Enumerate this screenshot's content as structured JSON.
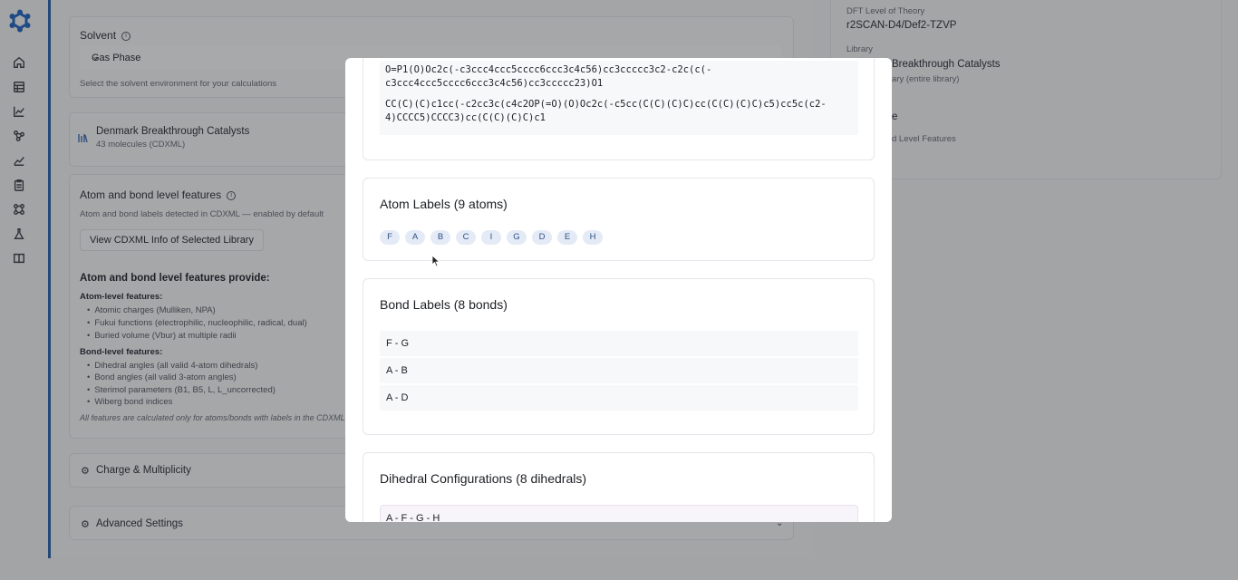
{
  "nav": {
    "icons": [
      "home-icon",
      "table-icon",
      "chart-line-icon",
      "molecule-icon",
      "trend-icon",
      "clipboard-icon",
      "network-icon",
      "flask-icon",
      "book-icon"
    ]
  },
  "solvent": {
    "label": "Solvent",
    "selected": "Gas Phase",
    "helper": "Select the solvent environment for your calculations"
  },
  "library_card": {
    "name": "Denmark Breakthrough Catalysts",
    "meta": "43 molecules (CDXML)"
  },
  "features": {
    "label": "Atom and bond level features",
    "helper": "Atom and bond labels detected in CDXML — enabled by default",
    "view_button": "View CDXML Info of Selected Library",
    "provides_title": "Atom and bond level features provide:",
    "atom_heading": "Atom-level features:",
    "atom_items": [
      "Atomic charges (Mulliken, NPA)",
      "Fukui functions (electrophilic, nucleophilic, radical, dual)",
      "Buried volume (Vbur) at multiple radii"
    ],
    "bond_heading": "Bond-level features:",
    "bond_items": [
      "Dihedral angles (all valid 4-atom dihedrals)",
      "Bond angles (all valid 3-atom angles)",
      "Sterimol parameters (B1, B5, L, L_uncorrected)",
      "Wiberg bond indices"
    ],
    "note": "All features are calculated only for atoms/bonds with labels in the CDXML"
  },
  "charge": {
    "label": "Charge & Multiplicity"
  },
  "advanced": {
    "label": "Advanced Settings"
  },
  "summary": {
    "dft_label": "DFT Level of Theory",
    "dft_value": "r2SCAN-D4/Def2-TZVP",
    "library_label": "Library",
    "library_value": "Breakthrough Catalysts",
    "library_meta": "ary (entire library)",
    "features_partial": "e",
    "features_meta": "d Level Features"
  },
  "modal": {
    "smiles": [
      "O=P1(O)Oc2c(-c3ccc4ccc5cccc6ccc3c4c56)cc3ccccc3c2-c2c(c(-\nc3ccc4ccc5cccc6ccc3c4c56)cc3ccccc23)O1",
      "CC(C)(C)c1cc(-c2cc3c(c4c2OP(=O)(O)Oc2c(-c5cc(C(C)(C)C)cc(C(C)(C)C)c5)cc5c(c2-\n4)CCCC5)CCCC3)cc(C(C)(C)C)c1"
    ],
    "atom_title": "Atom Labels (9 atoms)",
    "atoms": [
      "F",
      "A",
      "B",
      "C",
      "I",
      "G",
      "D",
      "E",
      "H"
    ],
    "bond_title": "Bond Labels (8 bonds)",
    "bonds": [
      "F - G",
      "A - B",
      "A - D"
    ],
    "dihedral_title": "Dihedral Configurations (8 dihedrals)",
    "dihedrals": [
      "A - F - G - H"
    ]
  }
}
